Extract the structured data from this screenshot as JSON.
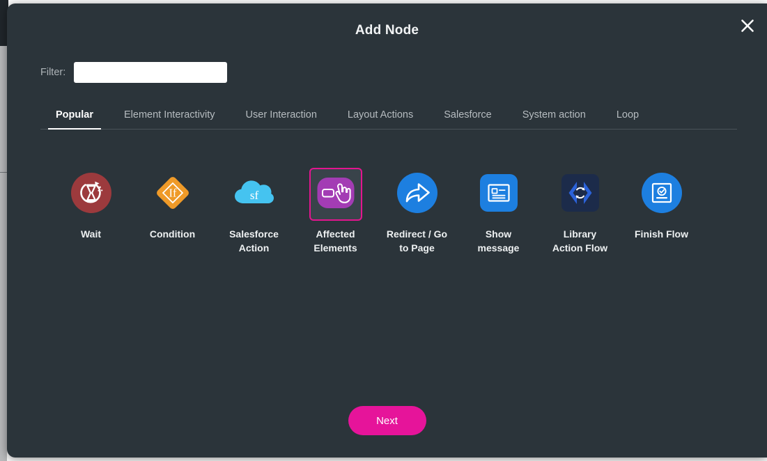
{
  "modal": {
    "title": "Add Node",
    "close_icon": "close-icon"
  },
  "filter": {
    "label": "Filter:",
    "value": "",
    "placeholder": ""
  },
  "tabs": [
    {
      "label": "Popular",
      "active": true
    },
    {
      "label": "Element Interactivity",
      "active": false
    },
    {
      "label": "User Interaction",
      "active": false
    },
    {
      "label": "Layout Actions",
      "active": false
    },
    {
      "label": "Salesforce",
      "active": false
    },
    {
      "label": "System action",
      "active": false
    },
    {
      "label": "Loop",
      "active": false
    }
  ],
  "nodes": [
    {
      "label": "Wait",
      "icon": "hourglass-wait-icon",
      "selected": false
    },
    {
      "label": "Condition",
      "icon": "condition-diamond-if-icon",
      "selected": false
    },
    {
      "label": "Salesforce\nAction",
      "icon": "salesforce-cloud-icon",
      "selected": false
    },
    {
      "label": "Affected\nElements",
      "icon": "affected-elements-hand-icon",
      "selected": true
    },
    {
      "label": "Redirect / Go\nto Page",
      "icon": "redirect-arrow-icon",
      "selected": false
    },
    {
      "label": "Show\nmessage",
      "icon": "show-message-icon",
      "selected": false
    },
    {
      "label": "Library\nAction Flow",
      "icon": "library-action-flow-icon",
      "selected": false
    },
    {
      "label": "Finish Flow",
      "icon": "finish-flow-icon",
      "selected": false
    }
  ],
  "footer": {
    "next_label": "Next"
  },
  "colors": {
    "modal_background": "#2b343a",
    "accent_pink": "#e6149a",
    "selection_border": "#e3158f",
    "wait_red": "#9c3a3d",
    "condition_orange": "#ef9a28",
    "salesforce_blue": "#45c3f0",
    "affected_purple": "#a33cb4",
    "action_blue": "#1d7fe0",
    "library_navy": "#1c2b4a"
  }
}
